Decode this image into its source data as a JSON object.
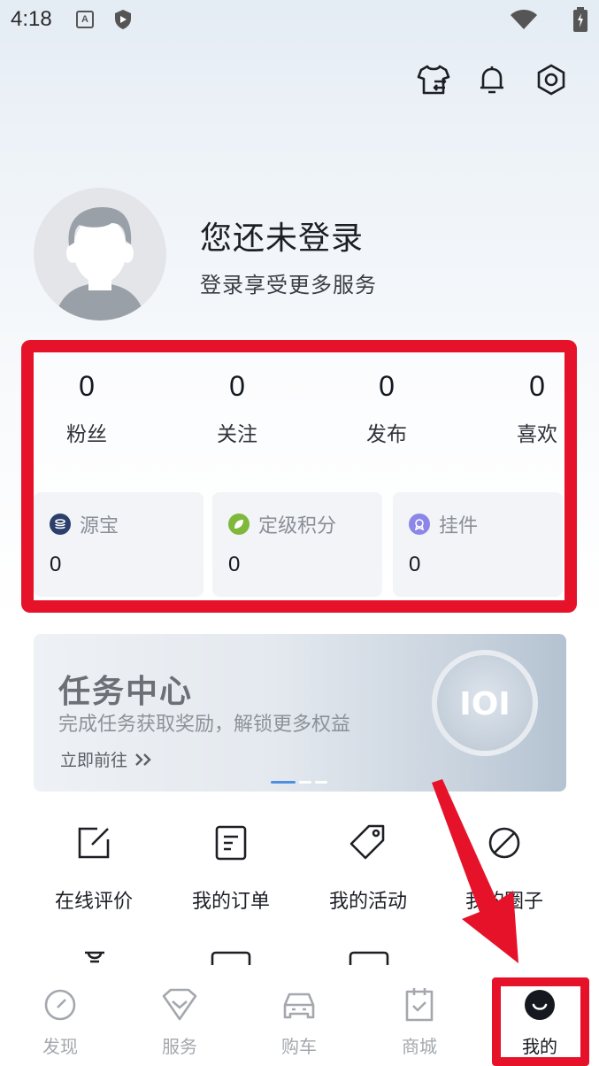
{
  "status_bar": {
    "time": "4:18",
    "notif_letter": "A"
  },
  "header": {
    "icons": [
      "wardrobe-icon",
      "bell-icon",
      "settings-hex-icon"
    ]
  },
  "profile": {
    "title": "您还未登录",
    "subtitle": "登录享受更多服务"
  },
  "stats": [
    {
      "value": "0",
      "label": "粉丝"
    },
    {
      "value": "0",
      "label": "关注"
    },
    {
      "value": "0",
      "label": "发布"
    },
    {
      "value": "0",
      "label": "喜欢"
    }
  ],
  "wallet": [
    {
      "label": "源宝",
      "value": "0",
      "icon": "coin-stack-icon",
      "color": "#2c3e6b"
    },
    {
      "label": "定级积分",
      "value": "0",
      "icon": "leaf-icon",
      "color": "#7fb83a"
    },
    {
      "label": "挂件",
      "value": "0",
      "icon": "medal-icon",
      "color": "#8c86e8"
    }
  ],
  "banner": {
    "title": "任务中心",
    "subtitle": "完成任务获取奖励，解锁更多权益",
    "link": "立即前往",
    "badge_text": "IOI"
  },
  "grid": [
    {
      "label": "在线评价",
      "icon": "edit-square-icon"
    },
    {
      "label": "我的订单",
      "icon": "order-doc-icon"
    },
    {
      "label": "我的活动",
      "icon": "tag-icon"
    },
    {
      "label": "我的圈子",
      "icon": "circle-link-icon"
    }
  ],
  "bottom_nav": [
    {
      "label": "发现",
      "icon": "compass-icon"
    },
    {
      "label": "服务",
      "icon": "heart-diamond-icon"
    },
    {
      "label": "购车",
      "icon": "car-icon"
    },
    {
      "label": "商城",
      "icon": "shop-bag-icon"
    },
    {
      "label": "我的",
      "icon": "smile-icon",
      "active": true
    }
  ],
  "accent": "#e5122a"
}
